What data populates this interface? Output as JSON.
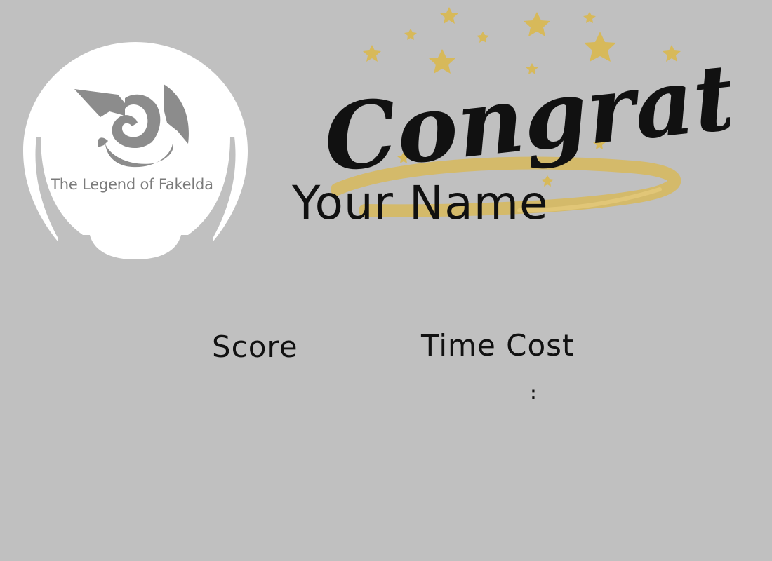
{
  "logo": {
    "title": "The Legend of Fakelda",
    "icon": "dragon-icon"
  },
  "banner": {
    "headline": "Congrats!",
    "icon": "star-icon"
  },
  "player": {
    "name": "Your Name"
  },
  "stats": {
    "score_label": "Score",
    "score_value": "",
    "time_label": "Time Cost",
    "time_value": ":"
  },
  "colors": {
    "background": "#c0c0c0",
    "logo_fill": "#ffffff",
    "logo_gray": "#7a7a7a",
    "gold": "#d7b95a",
    "ink": "#111111"
  }
}
